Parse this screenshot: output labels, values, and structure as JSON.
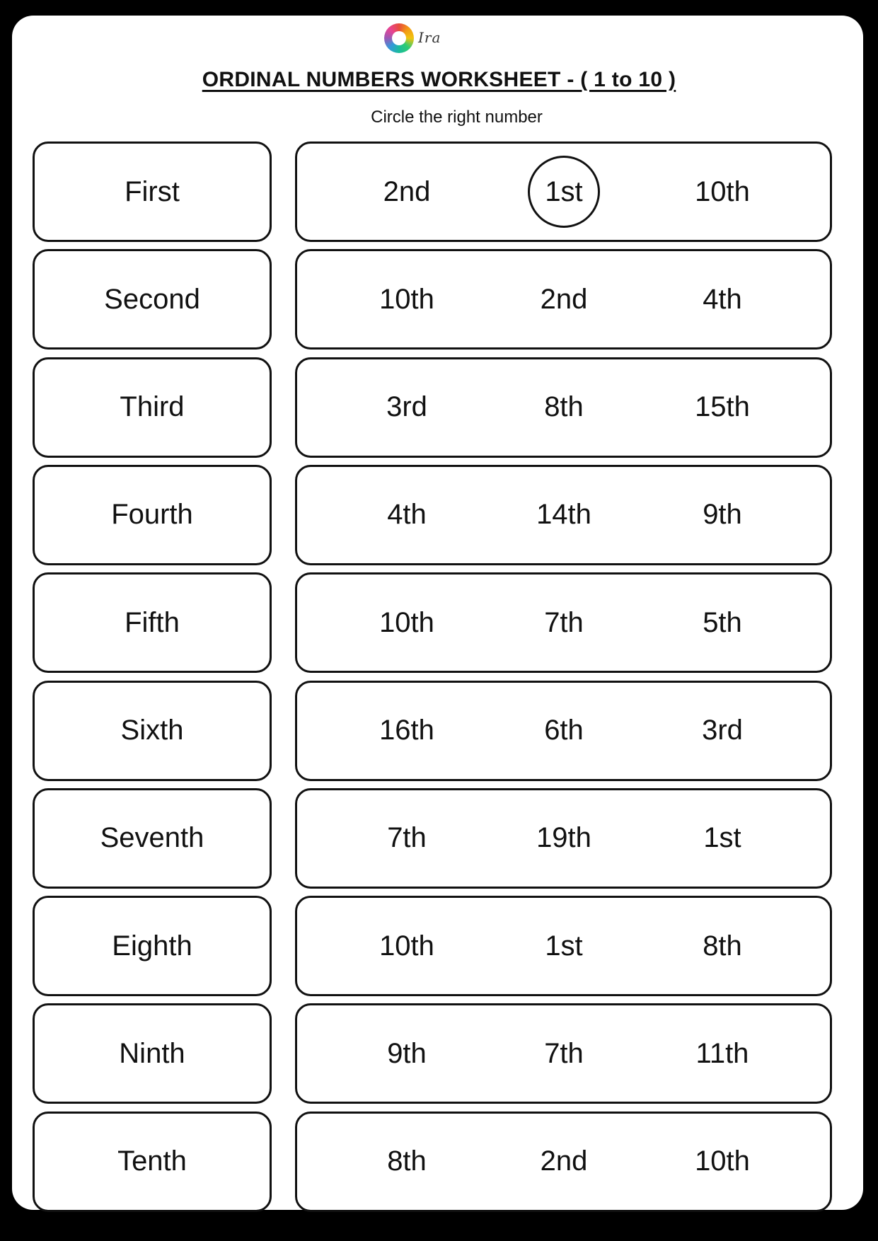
{
  "header": {
    "logo_icon": "color-wheel-logo-icon",
    "logo_text": "Ira",
    "title": "ORDINAL NUMBERS WORKSHEET - ( 1 to 10 )",
    "instruction": "Circle the right number"
  },
  "rows": [
    {
      "word": "First",
      "options": [
        "2nd",
        "1st",
        "10th"
      ],
      "circled_index": 1
    },
    {
      "word": "Second",
      "options": [
        "10th",
        "2nd",
        "4th"
      ],
      "circled_index": null
    },
    {
      "word": "Third",
      "options": [
        "3rd",
        "8th",
        "15th"
      ],
      "circled_index": null
    },
    {
      "word": "Fourth",
      "options": [
        "4th",
        "14th",
        "9th"
      ],
      "circled_index": null
    },
    {
      "word": "Fifth",
      "options": [
        "10th",
        "7th",
        "5th"
      ],
      "circled_index": null
    },
    {
      "word": "Sixth",
      "options": [
        "16th",
        "6th",
        "3rd"
      ],
      "circled_index": null
    },
    {
      "word": "Seventh",
      "options": [
        "7th",
        "19th",
        "1st"
      ],
      "circled_index": null
    },
    {
      "word": "Eighth",
      "options": [
        "10th",
        "1st",
        "8th"
      ],
      "circled_index": null
    },
    {
      "word": "Ninth",
      "options": [
        "9th",
        "7th",
        "11th"
      ],
      "circled_index": null
    },
    {
      "word": "Tenth",
      "options": [
        "8th",
        "2nd",
        "10th"
      ],
      "circled_index": null
    }
  ]
}
